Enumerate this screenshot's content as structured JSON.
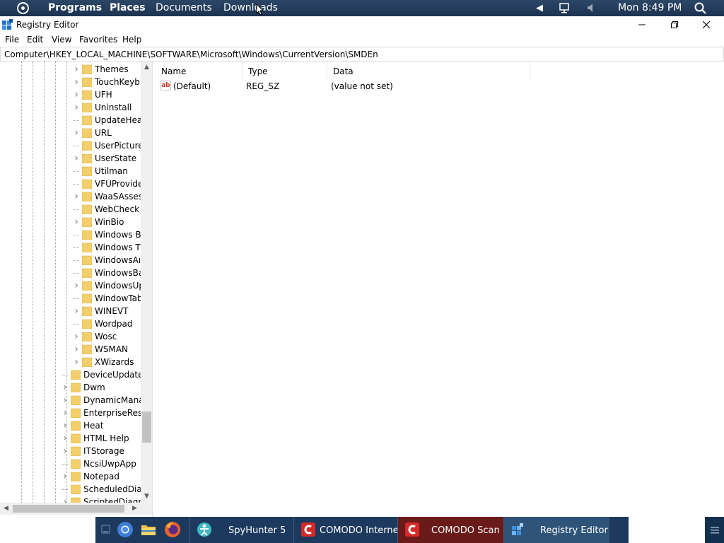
{
  "top_panel": {
    "menu": [
      "Programs",
      "Places",
      "Documents",
      "Downloads"
    ],
    "clock": "Mon 8:49 PM"
  },
  "window": {
    "title": "Registry Editor",
    "menu": [
      "File",
      "Edit",
      "View",
      "Favorites",
      "Help"
    ],
    "address": "Computer\\HKEY_LOCAL_MACHINE\\SOFTWARE\\Microsoft\\Windows\\CurrentVersion\\SMDEn"
  },
  "tree": {
    "items": [
      {
        "label": "Themes",
        "level": 2,
        "expandable": true
      },
      {
        "label": "TouchKeyb",
        "level": 2,
        "expandable": true
      },
      {
        "label": "UFH",
        "level": 2,
        "expandable": true
      },
      {
        "label": "Uninstall",
        "level": 2,
        "expandable": true
      },
      {
        "label": "UpdateHea",
        "level": 2,
        "expandable": false
      },
      {
        "label": "URL",
        "level": 2,
        "expandable": true
      },
      {
        "label": "UserPicture",
        "level": 2,
        "expandable": false
      },
      {
        "label": "UserState",
        "level": 2,
        "expandable": true
      },
      {
        "label": "Utilman",
        "level": 2,
        "expandable": false
      },
      {
        "label": "VFUProvide",
        "level": 2,
        "expandable": false
      },
      {
        "label": "WaaSAsses",
        "level": 2,
        "expandable": true
      },
      {
        "label": "WebCheck",
        "level": 2,
        "expandable": false
      },
      {
        "label": "WinBio",
        "level": 2,
        "expandable": true
      },
      {
        "label": "Windows B",
        "level": 2,
        "expandable": false
      },
      {
        "label": "Windows T",
        "level": 2,
        "expandable": false
      },
      {
        "label": "WindowsAı",
        "level": 2,
        "expandable": false
      },
      {
        "label": "WindowsBa",
        "level": 2,
        "expandable": false
      },
      {
        "label": "WindowsUp",
        "level": 2,
        "expandable": true
      },
      {
        "label": "WindowTab",
        "level": 2,
        "expandable": false
      },
      {
        "label": "WINEVT",
        "level": 2,
        "expandable": true
      },
      {
        "label": "Wordpad",
        "level": 2,
        "expandable": false
      },
      {
        "label": "Wosc",
        "level": 2,
        "expandable": true
      },
      {
        "label": "WSMAN",
        "level": 2,
        "expandable": true
      },
      {
        "label": "XWizards",
        "level": 2,
        "expandable": true
      },
      {
        "label": "DeviceUpdate",
        "level": 1,
        "expandable": false
      },
      {
        "label": "Dwm",
        "level": 1,
        "expandable": true
      },
      {
        "label": "DynamicMana",
        "level": 1,
        "expandable": true
      },
      {
        "label": "EnterpriseResc",
        "level": 1,
        "expandable": true
      },
      {
        "label": "Heat",
        "level": 1,
        "expandable": true
      },
      {
        "label": "HTML Help",
        "level": 1,
        "expandable": true
      },
      {
        "label": "ITStorage",
        "level": 1,
        "expandable": true
      },
      {
        "label": "NcsiUwpApp",
        "level": 1,
        "expandable": false
      },
      {
        "label": "Notepad",
        "level": 1,
        "expandable": true
      },
      {
        "label": "ScheduledDiag",
        "level": 1,
        "expandable": false
      },
      {
        "label": "ScriptedDiagn",
        "level": 1,
        "expandable": true
      }
    ]
  },
  "values": {
    "columns": {
      "name": "Name",
      "type": "Type",
      "data": "Data"
    },
    "rows": [
      {
        "name": "(Default)",
        "type": "REG_SZ",
        "data": "(value not set)",
        "icon": "string-value-icon"
      }
    ]
  },
  "taskbar": {
    "tasks": [
      {
        "label": "SpyHunter 5",
        "icon": "spyhunter-icon"
      },
      {
        "label": "COMODO Interne...",
        "icon": "comodo-icon"
      },
      {
        "label": "COMODO Scan",
        "icon": "comodo-icon"
      },
      {
        "label": "Registry Editor",
        "icon": "registry-editor-icon"
      }
    ]
  },
  "colors": {
    "panel": "#1c3350",
    "taskbar": "#1d3a5e",
    "comodo_task": "#6b1a1a",
    "folder": "#f2cf6b"
  }
}
